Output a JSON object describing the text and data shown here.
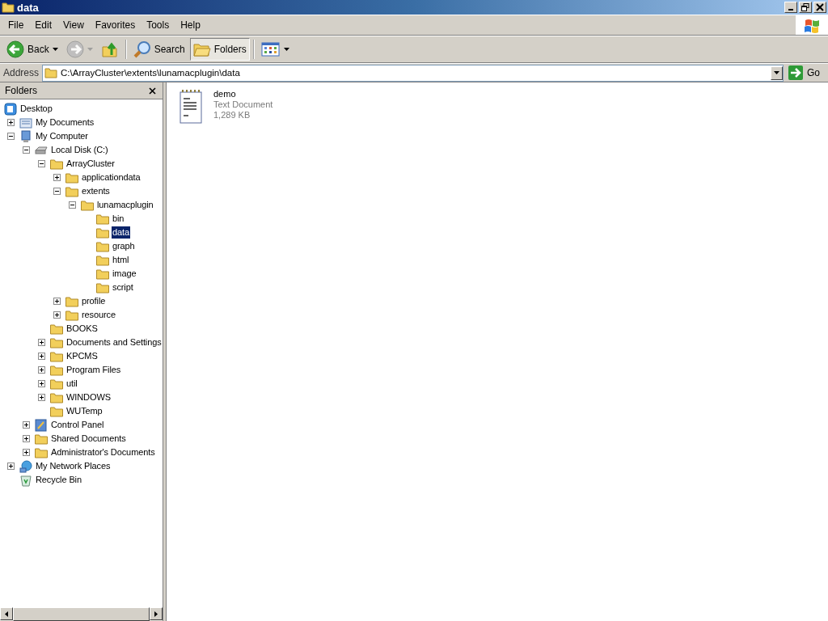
{
  "window": {
    "title": "data"
  },
  "menu": [
    "File",
    "Edit",
    "View",
    "Favorites",
    "Tools",
    "Help"
  ],
  "toolbar": [
    {
      "kind": "back",
      "label": "Back",
      "disabled": false,
      "pressed": false
    },
    {
      "kind": "forward",
      "disabled": true,
      "pressed": false
    },
    {
      "kind": "up",
      "disabled": false,
      "pressed": false
    },
    {
      "kind": "search",
      "label": "Search",
      "disabled": false,
      "pressed": false
    },
    {
      "kind": "folders",
      "label": "Folders",
      "disabled": false,
      "pressed": true
    },
    {
      "kind": "views",
      "disabled": false,
      "pressed": false
    }
  ],
  "address": {
    "label": "Address",
    "value": "C:\\ArrayCluster\\extents\\lunamacplugin\\data",
    "go": "Go"
  },
  "folders_pane": {
    "title": "Folders",
    "tree": [
      {
        "label": "Desktop",
        "kind": "desktop",
        "selected": false,
        "children": [
          {
            "label": "My Documents",
            "kind": "documents",
            "expanded": false,
            "selected": false
          },
          {
            "label": "My Computer",
            "kind": "computer",
            "expanded": true,
            "selected": false,
            "children": [
              {
                "label": "Local Disk (C:)",
                "kind": "drive",
                "expanded": true,
                "selected": false,
                "children": [
                  {
                    "label": "ArrayCluster",
                    "kind": "folder",
                    "expanded": true,
                    "selected": false,
                    "children": [
                      {
                        "label": "applicationdata",
                        "kind": "folder",
                        "expanded": false,
                        "selected": false
                      },
                      {
                        "label": "extents",
                        "kind": "folder",
                        "expanded": true,
                        "selected": false,
                        "children": [
                          {
                            "label": "lunamacplugin",
                            "kind": "folder",
                            "expanded": true,
                            "selected": false,
                            "children": [
                              {
                                "label": "bin",
                                "kind": "folder",
                                "selected": false
                              },
                              {
                                "label": "data",
                                "kind": "folder",
                                "selected": true
                              },
                              {
                                "label": "graph",
                                "kind": "folder",
                                "selected": false
                              },
                              {
                                "label": "html",
                                "kind": "folder",
                                "selected": false
                              },
                              {
                                "label": "image",
                                "kind": "folder",
                                "selected": false
                              },
                              {
                                "label": "script",
                                "kind": "folder",
                                "selected": false
                              }
                            ]
                          }
                        ]
                      },
                      {
                        "label": "profile",
                        "kind": "folder",
                        "expanded": false,
                        "selected": false
                      },
                      {
                        "label": "resource",
                        "kind": "folder",
                        "expanded": false,
                        "selected": false
                      }
                    ]
                  },
                  {
                    "label": "BOOKS",
                    "kind": "folder",
                    "selected": false
                  },
                  {
                    "label": "Documents and Settings",
                    "kind": "folder",
                    "expanded": false,
                    "selected": false
                  },
                  {
                    "label": "KPCMS",
                    "kind": "folder",
                    "expanded": false,
                    "selected": false
                  },
                  {
                    "label": "Program Files",
                    "kind": "folder",
                    "expanded": false,
                    "selected": false
                  },
                  {
                    "label": "util",
                    "kind": "folder",
                    "expanded": false,
                    "selected": false
                  },
                  {
                    "label": "WINDOWS",
                    "kind": "folder",
                    "expanded": false,
                    "selected": false
                  },
                  {
                    "label": "WUTemp",
                    "kind": "folder",
                    "selected": false
                  }
                ]
              },
              {
                "label": "Control Panel",
                "kind": "control-panel",
                "expanded": false,
                "selected": false
              },
              {
                "label": "Shared Documents",
                "kind": "folder",
                "expanded": false,
                "selected": false
              },
              {
                "label": "Administrator's Documents",
                "kind": "folder",
                "expanded": false,
                "selected": false
              }
            ]
          },
          {
            "label": "My Network Places",
            "kind": "network",
            "expanded": false,
            "selected": false
          },
          {
            "label": "Recycle Bin",
            "kind": "recycle",
            "selected": false
          }
        ]
      }
    ]
  },
  "files": [
    {
      "name": "demo",
      "type": "Text Document",
      "size": "1,289 KB"
    }
  ]
}
